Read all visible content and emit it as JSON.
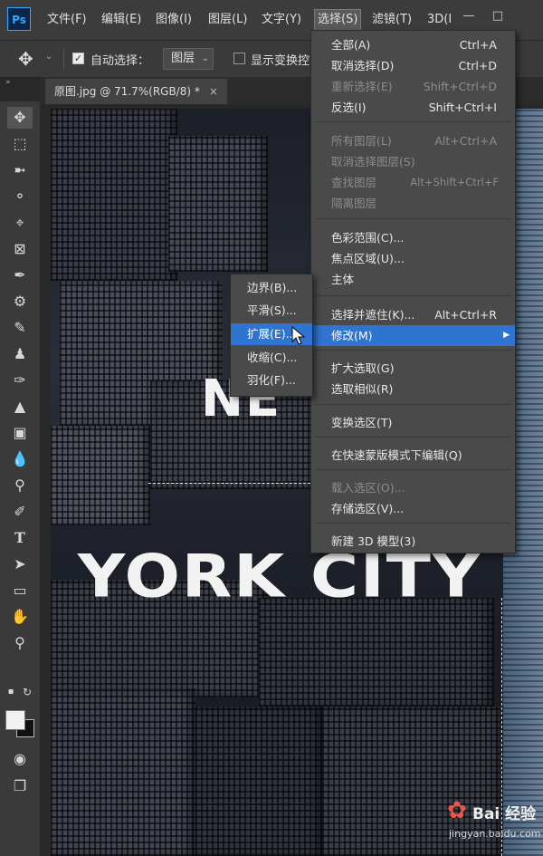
{
  "app": {
    "logo": "Ps"
  },
  "menubar": {
    "items": [
      "文件(F)",
      "编辑(E)",
      "图像(I)",
      "图层(L)",
      "文字(Y)",
      "选择(S)",
      "滤镜(T)",
      "3D(I"
    ],
    "active": "选择(S)",
    "window_controls": [
      "minimize-icon",
      "maximize-icon"
    ]
  },
  "options_bar": {
    "tool_icon": "move-icon",
    "auto_select_label": "自动选择：",
    "auto_select_checked": true,
    "auto_select_target": "图层",
    "show_transform_label": "显示变换控",
    "show_transform_checked": false
  },
  "document_tab": {
    "title": "原图.jpg @ 71.7%(RGB/8) *",
    "close": "×"
  },
  "toolbar": {
    "tools": [
      "move-icon",
      "marquee-icon",
      "lasso-icon",
      "quick-select-icon",
      "crop-icon",
      "frame-icon",
      "eyedropper-icon",
      "healing-icon",
      "brush-icon",
      "stamp-icon",
      "history-brush-icon",
      "eraser-icon",
      "gradient-icon",
      "blur-icon",
      "dodge-icon",
      "pen-icon",
      "type-icon",
      "path-select-icon",
      "rectangle-icon",
      "hand-icon",
      "zoom-icon"
    ],
    "extra_icons": [
      "quick-mask-icon",
      "screen-mode-icon"
    ]
  },
  "canvas": {
    "text_line1": "NE",
    "text_line2": "YORK CITY"
  },
  "select_menu": {
    "items": [
      {
        "label": "全部(A)",
        "shortcut": "Ctrl+A",
        "disabled": false
      },
      {
        "label": "取消选择(D)",
        "shortcut": "Ctrl+D",
        "disabled": false
      },
      {
        "label": "重新选择(E)",
        "shortcut": "Shift+Ctrl+D",
        "disabled": true
      },
      {
        "label": "反选(I)",
        "shortcut": "Shift+Ctrl+I",
        "disabled": false
      },
      {
        "label": "所有图层(L)",
        "shortcut": "Alt+Ctrl+A",
        "disabled": true
      },
      {
        "label": "取消选择图层(S)",
        "shortcut": "",
        "disabled": true
      },
      {
        "label": "查找图层",
        "shortcut": "Alt+Shift+Ctrl+F",
        "disabled": true
      },
      {
        "label": "隔离图层",
        "shortcut": "",
        "disabled": true
      },
      {
        "label": "色彩范围(C)...",
        "shortcut": "",
        "disabled": false
      },
      {
        "label": "焦点区域(U)...",
        "shortcut": "",
        "disabled": false
      },
      {
        "label": "主体",
        "shortcut": "",
        "disabled": false
      },
      {
        "label": "选择并遮住(K)...",
        "shortcut": "Alt+Ctrl+R",
        "disabled": false
      },
      {
        "label": "修改(M)",
        "shortcut": "",
        "disabled": false,
        "highlighted": true,
        "submenu": true
      },
      {
        "label": "扩大选取(G)",
        "shortcut": "",
        "disabled": false
      },
      {
        "label": "选取相似(R)",
        "shortcut": "",
        "disabled": false
      },
      {
        "label": "变换选区(T)",
        "shortcut": "",
        "disabled": false
      },
      {
        "label": "在快速蒙版模式下编辑(Q)",
        "shortcut": "",
        "disabled": false
      },
      {
        "label": "载入选区(O)...",
        "shortcut": "",
        "disabled": true
      },
      {
        "label": "存储选区(V)...",
        "shortcut": "",
        "disabled": false
      },
      {
        "label": "新建 3D 模型(3)",
        "shortcut": "",
        "disabled": false
      }
    ]
  },
  "modify_submenu": {
    "items": [
      {
        "label": "边界(B)...",
        "highlighted": false
      },
      {
        "label": "平滑(S)...",
        "highlighted": false
      },
      {
        "label": "扩展(E)...",
        "highlighted": true
      },
      {
        "label": "收缩(C)...",
        "highlighted": false
      },
      {
        "label": "羽化(F)...",
        "highlighted": false
      }
    ]
  },
  "watermark": {
    "logo": "Bai 经验",
    "url": "jingyan.baidu.com"
  },
  "colors": {
    "highlight": "#2f74d0",
    "menu_bg": "#4a4a4a"
  }
}
